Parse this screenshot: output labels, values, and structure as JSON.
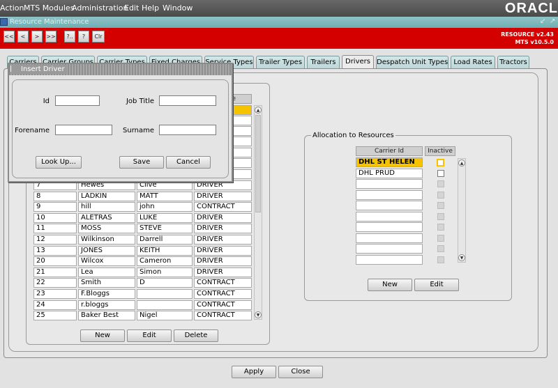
{
  "menu": [
    "Action",
    "MTS Modules",
    "Administration",
    "Edit",
    "Help",
    "Window"
  ],
  "brand": "ORACL",
  "window_title": "Resource Maintenance",
  "window_controls": [
    "↙",
    "↗"
  ],
  "toolbar": {
    "buttons": [
      "<<",
      "<",
      ">",
      ">>",
      "?..",
      "?",
      "Clr"
    ],
    "version_line1": "RESOURCE v2.43",
    "version_line2": "MTS v10.5.0"
  },
  "tabs": [
    "Carriers",
    "Carrier Groups",
    "Carrier Types",
    "Fixed Charges",
    "Service Types",
    "Trailer Types",
    "Trailers",
    "Drivers",
    "Despatch Unit Types",
    "Load Rates",
    "Tractors"
  ],
  "active_tab": "Drivers",
  "drivers": {
    "header_fragment": "e",
    "rows": [
      [
        "7",
        "Hewes",
        "Clive",
        "DRIVER"
      ],
      [
        "8",
        "LADKIN",
        "MATT",
        "DRIVER"
      ],
      [
        "9",
        "hill",
        "john",
        "CONTRACT"
      ],
      [
        "10",
        "ALETRAS",
        "LUKE",
        "DRIVER"
      ],
      [
        "11",
        "MOSS",
        "STEVE",
        "DRIVER"
      ],
      [
        "12",
        "Wilkinson",
        "Darrell",
        "DRIVER"
      ],
      [
        "13",
        "JONES",
        "KEITH",
        "DRIVER"
      ],
      [
        "20",
        "Wilcox",
        "Cameron",
        "DRIVER"
      ],
      [
        "21",
        "Lea",
        "Simon",
        "DRIVER"
      ],
      [
        "22",
        "Smith",
        "D",
        "CONTRACT"
      ],
      [
        "23",
        "F.Bloggs",
        "",
        "CONTRACT"
      ],
      [
        "24",
        "r.bloggs",
        "",
        "CONTRACT"
      ],
      [
        "25",
        "Baker Best",
        "Nigel",
        "CONTRACT"
      ]
    ],
    "buttons": {
      "new": "New",
      "edit": "Edit",
      "delete": "Delete"
    }
  },
  "allocation": {
    "title": "Allocation to Resources",
    "col_carrier": "Carrier Id",
    "col_inactive": "Inactive",
    "rows": [
      "DHL ST HELEN",
      "DHL PRUD"
    ],
    "buttons": {
      "new": "New",
      "edit": "Edit"
    }
  },
  "footer": {
    "apply": "Apply",
    "close": "Close"
  },
  "dialog": {
    "title": "Insert Driver",
    "id_label": "Id",
    "job_title_label": "Job Title",
    "forename_label": "Forename",
    "surname_label": "Surname",
    "lookup": "Look Up...",
    "save": "Save",
    "cancel": "Cancel",
    "values": {
      "id": "",
      "job_title": "",
      "forename": "",
      "surname": ""
    }
  },
  "colors": {
    "toolbar_red": "#d40000",
    "selection_yellow": "#f5c300",
    "title_teal": "#7fb8bc"
  }
}
